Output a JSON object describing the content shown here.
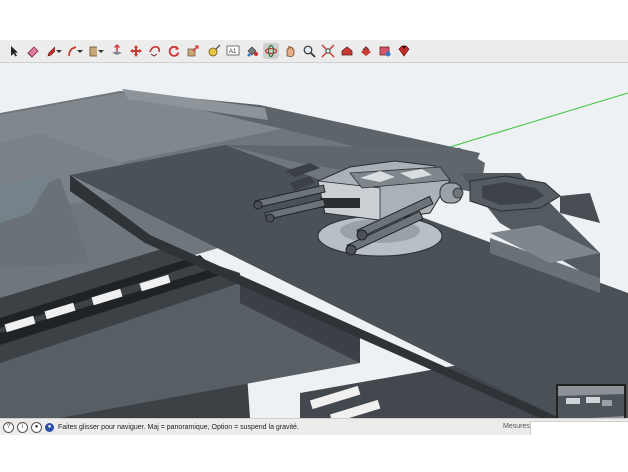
{
  "toolbar": {
    "tools": [
      {
        "name": "select-tool",
        "icon": "arrow-icon"
      },
      {
        "name": "eraser-tool",
        "icon": "eraser-icon"
      },
      {
        "name": "pencil-tool",
        "icon": "pencil-icon"
      },
      {
        "name": "arc-tool",
        "icon": "arc-icon"
      },
      {
        "name": "shape-tool",
        "icon": "rectangle-icon"
      },
      {
        "name": "push-pull-tool",
        "icon": "push-pull-icon"
      },
      {
        "name": "move-tool",
        "icon": "move-icon"
      },
      {
        "name": "follow-me-tool",
        "icon": "follow-me-icon"
      },
      {
        "name": "rotate-tool",
        "icon": "rotate-icon"
      },
      {
        "name": "scale-tool",
        "icon": "scale-icon"
      },
      {
        "name": "tape-measure-tool",
        "icon": "tape-measure-icon"
      },
      {
        "name": "text-tool",
        "icon": "text-icon"
      },
      {
        "name": "paint-bucket-tool",
        "icon": "paint-bucket-icon"
      },
      {
        "name": "orbit-tool",
        "icon": "orbit-icon"
      },
      {
        "name": "pan-tool",
        "icon": "pan-icon"
      },
      {
        "name": "zoom-tool",
        "icon": "zoom-icon"
      },
      {
        "name": "zoom-extents-tool",
        "icon": "zoom-extents-icon"
      },
      {
        "name": "warehouse-tool",
        "icon": "warehouse-icon"
      },
      {
        "name": "share-model-tool",
        "icon": "share-icon"
      },
      {
        "name": "extension-warehouse-tool",
        "icon": "extension-icon"
      },
      {
        "name": "ruby-tool",
        "icon": "ruby-icon"
      }
    ],
    "text_tool_glyph": "A1"
  },
  "status": {
    "message": "Faites glisser pour naviguer. Maj = panoramique, Option =  suspend la gravité.",
    "measurements_label": "Mesures",
    "measurements_value": ""
  },
  "colors": {
    "toolbar_bg": "#ececec",
    "accent_red": "#d0322e",
    "model_gray": "#4a5157",
    "sky": "#f1f3f4"
  }
}
